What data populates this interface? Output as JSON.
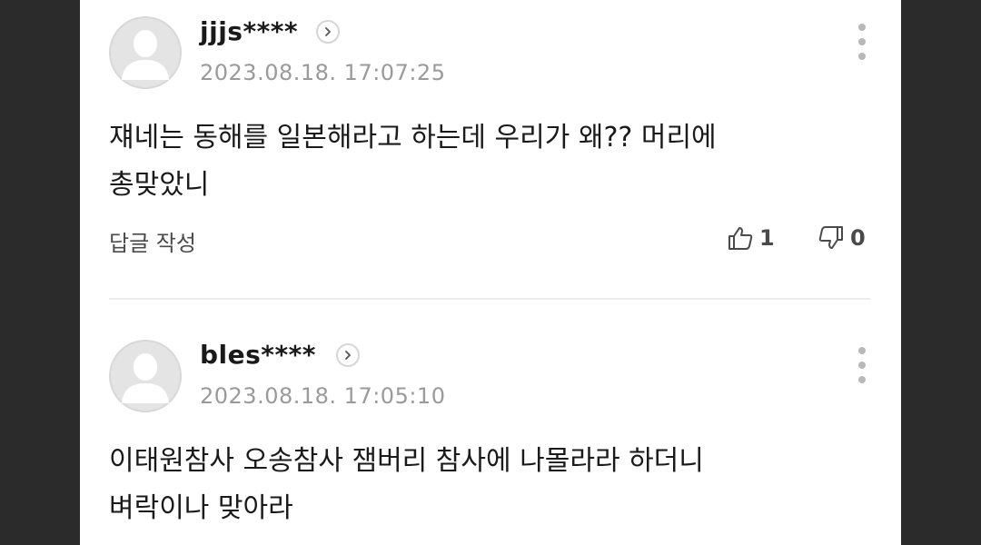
{
  "comments": [
    {
      "username": "jjjs****",
      "timestamp": "2023.08.18. 17:07:25",
      "text": "쟤네는 동해를 일본해라고 하는데 우리가 왜?? 머리에\n총맞았니",
      "reply_label": "답글 작성",
      "likes": "1",
      "dislikes": "0"
    },
    {
      "username": "bles****",
      "timestamp": "2023.08.18. 17:05:10",
      "text": "이태원참사 오송참사 잼버리 참사에 나몰라라 하더니\n벼락이나 맞아라"
    }
  ],
  "colors": {
    "background": "#2b2b2b",
    "panel": "#ffffff",
    "avatar": "#e4e4e4",
    "muted": "#9a9a9a"
  },
  "icons": [
    "profile-avatar-icon",
    "chevron-right-icon",
    "more-vertical-icon",
    "thumbs-up-icon",
    "thumbs-down-icon"
  ]
}
